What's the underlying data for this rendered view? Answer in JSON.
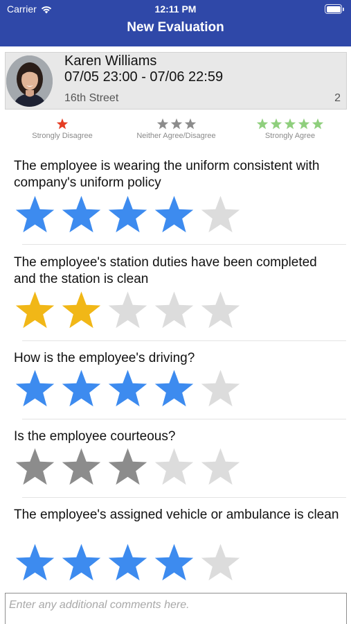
{
  "status_bar": {
    "carrier": "Carrier",
    "time": "12:11 PM"
  },
  "nav": {
    "title": "New Evaluation"
  },
  "profile": {
    "name": "Karen Williams",
    "dates": "07/05 23:00 - 07/06 22:59",
    "location": "16th Street",
    "count": "2"
  },
  "legend": [
    {
      "label": "Strongly Disagree",
      "stars": 1,
      "color": "#e53d23"
    },
    {
      "label": "Neither Agree/Disagree",
      "stars": 3,
      "color": "#8c8c8c"
    },
    {
      "label": "Strongly Agree",
      "stars": 5,
      "color": "#8fcf7d"
    }
  ],
  "colors": {
    "nav_bg": "#2f48a8",
    "star_empty": "#dcdcdc",
    "blue": "#3d8bef",
    "gold": "#f1b717",
    "gray": "#8c8c8c"
  },
  "questions": [
    {
      "text": "The employee is wearing the uniform consistent with company's uniform policy",
      "rating": 4,
      "max": 5,
      "color": "#3d8bef"
    },
    {
      "text": "The employee's station duties have been completed and the station is clean",
      "rating": 2,
      "max": 5,
      "color": "#f1b717"
    },
    {
      "text": "How is the employee's driving?",
      "rating": 4,
      "max": 5,
      "color": "#3d8bef"
    },
    {
      "text": "Is the employee courteous?",
      "rating": 3,
      "max": 5,
      "color": "#8c8c8c"
    },
    {
      "text": "The employee's assigned vehicle or ambulance is clean",
      "rating": 4,
      "max": 5,
      "color": "#3d8bef"
    }
  ],
  "comments": {
    "placeholder": "Enter any additional comments here.",
    "value": ""
  }
}
